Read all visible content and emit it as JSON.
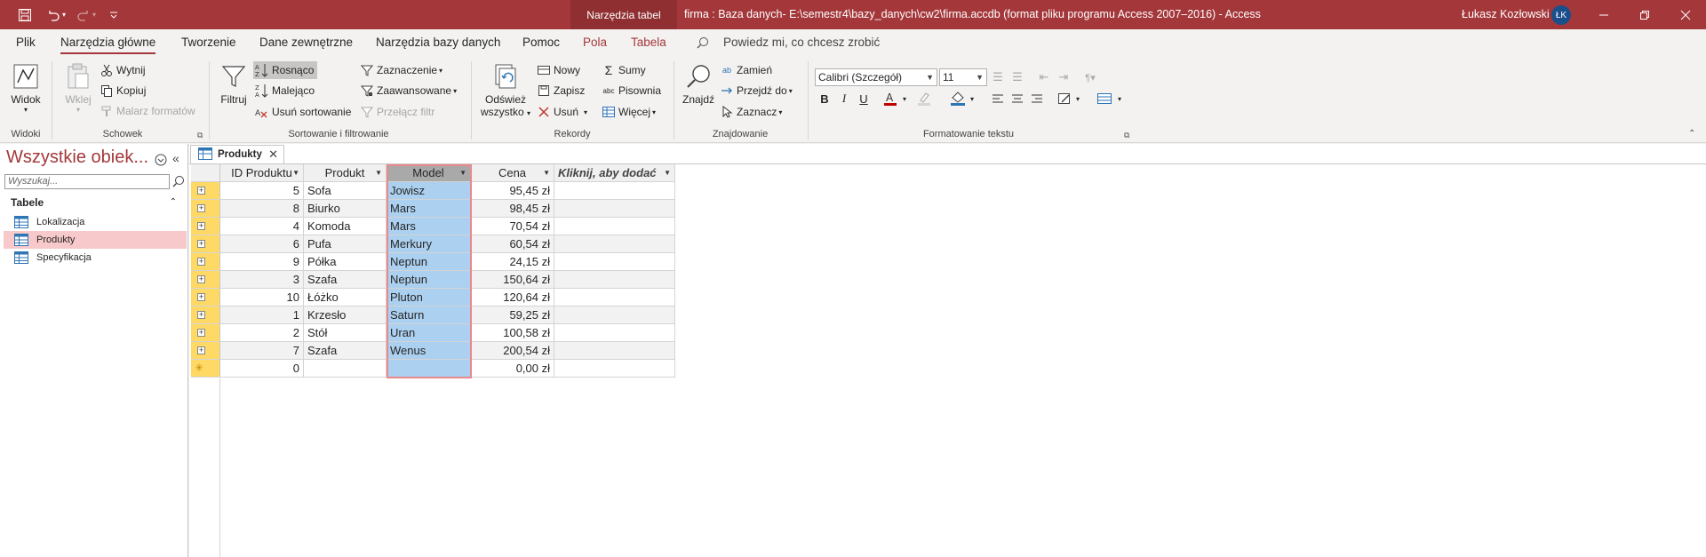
{
  "titlebar": {
    "context_tools": "Narzędzia tabel",
    "doc_title": "firma : Baza danych- E:\\semestr4\\bazy_danych\\cw2\\firma.accdb (format pliku programu Access 2007–2016)  -  Access",
    "user_name": "Łukasz Kozłowski",
    "avatar_initials": "ŁK",
    "accent": "#a4373a"
  },
  "menu": {
    "tabs": [
      "Plik",
      "Narzędzia główne",
      "Tworzenie",
      "Dane zewnętrzne",
      "Narzędzia bazy danych",
      "Pomoc",
      "Pola",
      "Tabela"
    ],
    "tell_me": "Powiedz mi, co chcesz zrobić"
  },
  "ribbon": {
    "widoki": {
      "view": "Widok",
      "label": "Widoki"
    },
    "schowek": {
      "paste": "Wklej",
      "cut": "Wytnij",
      "copy": "Kopiuj",
      "painter": "Malarz formatów",
      "label": "Schowek"
    },
    "sort": {
      "filter": "Filtruj",
      "asc": "Rosnąco",
      "desc": "Malejąco",
      "remove": "Usuń sortowanie",
      "selection": "Zaznaczenie",
      "advanced": "Zaawansowane",
      "toggle": "Przełącz filtr",
      "label": "Sortowanie i filtrowanie"
    },
    "rekordy": {
      "refresh_line1": "Odśwież",
      "refresh_line2": "wszystko",
      "new": "Nowy",
      "save": "Zapisz",
      "delete": "Usuń",
      "totals": "Sumy",
      "spelling": "Pisownia",
      "more": "Więcej",
      "label": "Rekordy"
    },
    "znajdowanie": {
      "find": "Znajdź",
      "replace": "Zamień",
      "goto": "Przejdź do",
      "select": "Zaznacz",
      "label": "Znajdowanie"
    },
    "format": {
      "font": "Calibri (Szczegół)",
      "size": "11",
      "label": "Formatowanie tekstu"
    }
  },
  "nav": {
    "title": "Wszystkie obiek...",
    "search_placeholder": "Wyszukaj...",
    "group": "Tabele",
    "items": [
      "Lokalizacja",
      "Produkty",
      "Specyfikacja"
    ]
  },
  "doc_tab": "Produkty",
  "table": {
    "headers": [
      "ID Produktu",
      "Produkt",
      "Model",
      "Cena",
      "Kliknij, aby dodać"
    ],
    "rows": [
      [
        "5",
        "Sofa",
        "Jowisz",
        "95,45 zł"
      ],
      [
        "8",
        "Biurko",
        "Mars",
        "98,45 zł"
      ],
      [
        "4",
        "Komoda",
        "Mars",
        "70,54 zł"
      ],
      [
        "6",
        "Pufa",
        "Merkury",
        "60,54 zł"
      ],
      [
        "9",
        "Półka",
        "Neptun",
        "24,15 zł"
      ],
      [
        "3",
        "Szafa",
        "Neptun",
        "150,64 zł"
      ],
      [
        "10",
        "Łóżko",
        "Pluton",
        "120,64 zł"
      ],
      [
        "1",
        "Krzesło",
        "Saturn",
        "59,25 zł"
      ],
      [
        "2",
        "Stół",
        "Uran",
        "100,58 zł"
      ],
      [
        "7",
        "Szafa",
        "Wenus",
        "200,54 zł"
      ]
    ],
    "new_row": [
      "0",
      "",
      "",
      "0,00 zł"
    ]
  }
}
